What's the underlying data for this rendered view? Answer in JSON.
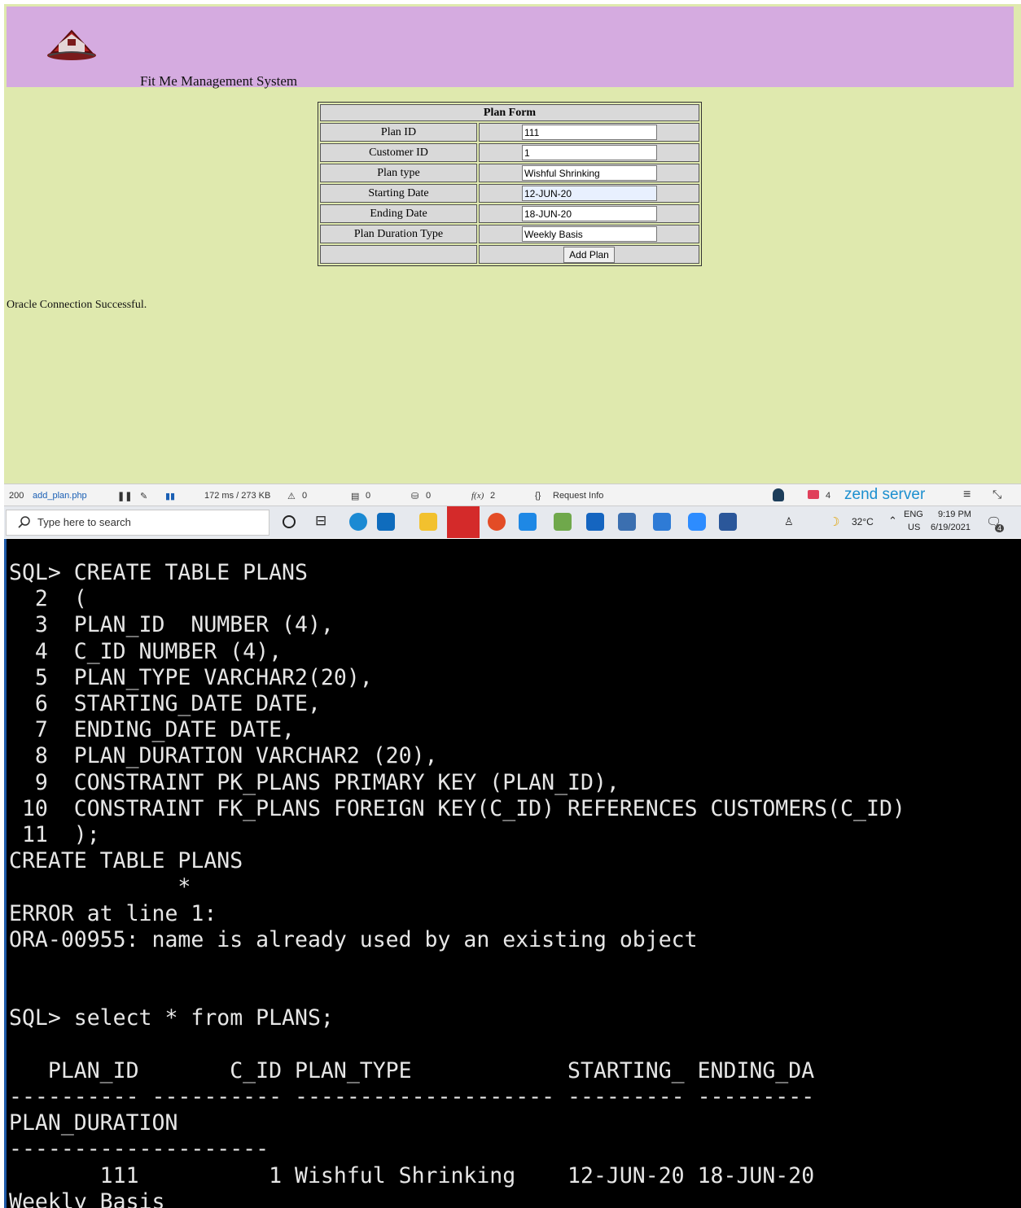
{
  "header": {
    "title": "Fit Me Management System",
    "logo_icon": "house-icon"
  },
  "form": {
    "caption": "Plan Form",
    "rows": [
      {
        "label": "Plan ID",
        "value": "111"
      },
      {
        "label": "Customer ID",
        "value": "1"
      },
      {
        "label": "Plan type",
        "value": "Wishful Shrinking"
      },
      {
        "label": "Starting Date",
        "value": "12-JUN-20"
      },
      {
        "label": "Ending Date",
        "value": "18-JUN-20"
      },
      {
        "label": "Plan Duration Type",
        "value": "Weekly Basis"
      }
    ],
    "submit_label": "Add Plan"
  },
  "status": {
    "message": "Oracle Connection Successful."
  },
  "devbar": {
    "status_code": "200",
    "file": "add_plan.php",
    "timing": "172 ms / 273 KB",
    "warnings": "0",
    "log_count": "0",
    "db_count": "0",
    "functions": "2",
    "request_info": "Request Info",
    "notifications": "4",
    "brand": "zend server"
  },
  "taskbar": {
    "search_placeholder": "Type here to search",
    "weather": "32°C",
    "lang_top": "ENG",
    "lang_bottom": "US",
    "time": "9:19 PM",
    "date": "6/19/2021",
    "notif_count": "4"
  },
  "terminal": {
    "lines": [
      "SQL> CREATE TABLE PLANS",
      "  2  (",
      "  3  PLAN_ID  NUMBER (4),",
      "  4  C_ID NUMBER (4),",
      "  5  PLAN_TYPE VARCHAR2(20),",
      "  6  STARTING_DATE DATE,",
      "  7  ENDING_DATE DATE,",
      "  8  PLAN_DURATION VARCHAR2 (20),",
      "  9  CONSTRAINT PK_PLANS PRIMARY KEY (PLAN_ID),",
      " 10  CONSTRAINT FK_PLANS FOREIGN KEY(C_ID) REFERENCES CUSTOMERS(C_ID)",
      " 11  );",
      "CREATE TABLE PLANS",
      "             *",
      "ERROR at line 1:",
      "ORA-00955: name is already used by an existing object",
      "",
      "",
      "SQL> select * from PLANS;",
      "",
      "   PLAN_ID       C_ID PLAN_TYPE            STARTING_ ENDING_DA",
      "---------- ---------- -------------------- --------- ---------",
      "PLAN_DURATION",
      "--------------------",
      "       111          1 Wishful Shrinking    12-JUN-20 18-JUN-20",
      "Weekly Basis"
    ]
  },
  "colors": {
    "header_bg": "#d5abe0",
    "page_bg": "#dfe9ae",
    "terminal_bg": "#000000",
    "terminal_fg": "#e6e6e6"
  }
}
